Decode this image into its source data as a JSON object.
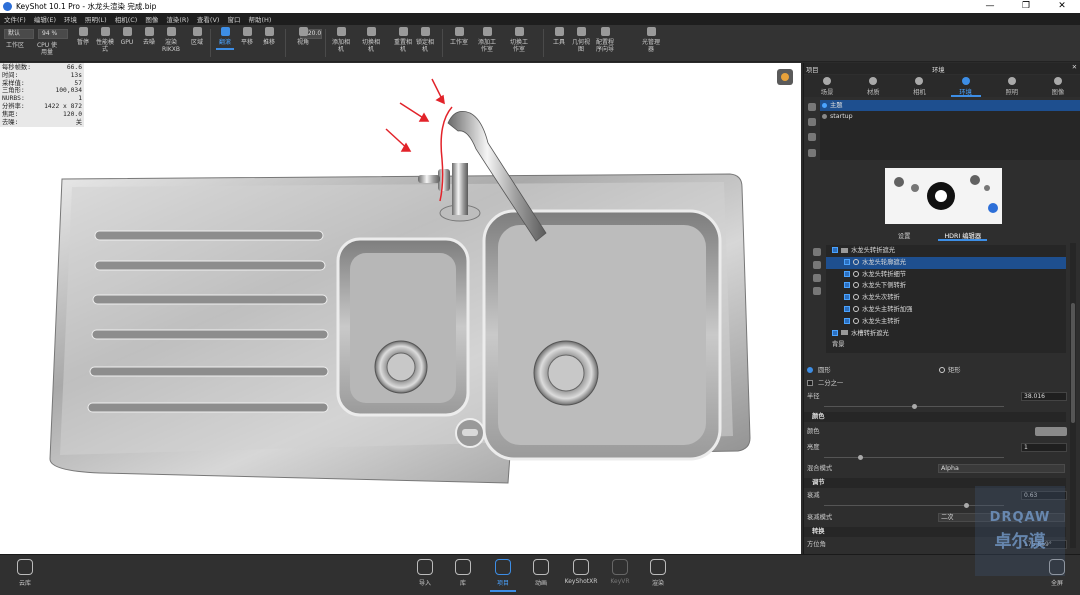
{
  "titlebar": {
    "title": "KeyShot 10.1 Pro - 水龙头渲染 完成.bip",
    "min": "—",
    "max": "❐",
    "close": "✕"
  },
  "menu": [
    "文件(F)",
    "编辑(E)",
    "环境",
    "照明(L)",
    "相机(C)",
    "图像",
    "渲染(R)",
    "查看(V)",
    "窗口",
    "帮助(H)"
  ],
  "toolbar": {
    "workspace_select": "默认",
    "zoom_select": "94 %",
    "view_angle_value": "120.0",
    "buttons": [
      {
        "label": "工作区",
        "icon": "workspace-icon"
      },
      {
        "label": "CPU 使用量",
        "icon": "cpu-icon"
      },
      {
        "label": "暂停",
        "icon": "pause-icon"
      },
      {
        "label": "性能模式",
        "icon": "performance-icon"
      },
      {
        "label": "GPU",
        "icon": "gpu-icon"
      },
      {
        "label": "去噪",
        "icon": "denoise-icon"
      },
      {
        "label": "渲染 RIKXB",
        "icon": "render-region-icon"
      },
      {
        "label": "区域",
        "icon": "region-icon"
      },
      {
        "label": "翻滚",
        "icon": "tumble-icon",
        "active": true
      },
      {
        "label": "平移",
        "icon": "pan-icon"
      },
      {
        "label": "推移",
        "icon": "dolly-icon"
      },
      {
        "label": "视角",
        "icon": "view-angle-icon"
      },
      {
        "label": "添加相机",
        "icon": "add-camera-icon"
      },
      {
        "label": "切换相机",
        "icon": "switch-camera-icon"
      },
      {
        "label": "重置相机",
        "icon": "reset-camera-icon"
      },
      {
        "label": "锁定相机",
        "icon": "lock-camera-icon"
      },
      {
        "label": "工作室",
        "icon": "studio-icon"
      },
      {
        "label": "添加工作室",
        "icon": "add-studio-icon"
      },
      {
        "label": "切换工作室",
        "icon": "switch-studio-icon"
      },
      {
        "label": "工具",
        "icon": "tools-icon"
      },
      {
        "label": "几何视图",
        "icon": "geometry-view-icon"
      },
      {
        "label": "配置程序向导",
        "icon": "configurator-icon"
      },
      {
        "label": "光管理器",
        "icon": "light-manager-icon"
      }
    ]
  },
  "stats": [
    {
      "k": "每秒帧数:",
      "v": "66.6"
    },
    {
      "k": "时间:",
      "v": "13s"
    },
    {
      "k": "采样值:",
      "v": "57"
    },
    {
      "k": "三角形:",
      "v": "100,034"
    },
    {
      "k": "NURBS:",
      "v": "1"
    },
    {
      "k": "分辨率:",
      "v": "1422 x 872"
    },
    {
      "k": "焦距:",
      "v": "120.0"
    },
    {
      "k": "去噪:",
      "v": "关"
    }
  ],
  "panel": {
    "header_left": "项目",
    "header_center": "环境",
    "tabs": [
      "场景",
      "材质",
      "相机",
      "环境",
      "照明",
      "图像"
    ],
    "active_tab": 3,
    "environments": [
      "主题",
      "startup"
    ],
    "sub_tabs": [
      "设置",
      "HDRI 编辑器"
    ],
    "tree": [
      {
        "label": "水龙头转折遮光",
        "level": 0,
        "folder": true
      },
      {
        "label": "水龙头轮廓遮光",
        "level": 1,
        "selected": true
      },
      {
        "label": "水龙头转折细节",
        "level": 1
      },
      {
        "label": "水龙头下侧转折",
        "level": 1
      },
      {
        "label": "水龙头次转折",
        "level": 1
      },
      {
        "label": "水龙头主转折加强",
        "level": 1
      },
      {
        "label": "水龙头主转折",
        "level": 1
      },
      {
        "label": "水槽转折遮光",
        "level": 0,
        "folder": true
      },
      {
        "label": "背景",
        "level": 0
      }
    ],
    "shape_circle": "圆形",
    "shape_rect": "矩形",
    "half_label": "二分之一",
    "radius_label": "半径",
    "radius_value": "38.016",
    "section_color": "颜色",
    "color_label": "颜色",
    "brightness_label": "亮度",
    "brightness_value": "1",
    "blend_label": "混合模式",
    "blend_value": "Alpha",
    "section_adjust": "调节",
    "falloff_label": "衰减",
    "falloff_value": "0.63",
    "falloff_mode_label": "衰减模式",
    "falloff_mode_value": "二次",
    "section_transform": "转换",
    "azimuth_label": "方位角",
    "azimuth_value": "175.869°"
  },
  "bottombar": [
    {
      "label": "云库",
      "icon": "cloud-library-icon"
    },
    {
      "label": "导入",
      "icon": "import-icon"
    },
    {
      "label": "库",
      "icon": "library-icon"
    },
    {
      "label": "项目",
      "icon": "project-icon",
      "active": true
    },
    {
      "label": "动画",
      "icon": "animation-icon"
    },
    {
      "label": "KeyShotXR",
      "icon": "keyshotxr-icon"
    },
    {
      "label": "KeyVR",
      "icon": "keyvr-icon",
      "dim": true
    },
    {
      "label": "渲染",
      "icon": "render-icon"
    },
    {
      "label": "全屏",
      "icon": "fullscreen-icon"
    }
  ],
  "watermark": {
    "line1": "DRQAW",
    "line2": "卓尔谟"
  }
}
